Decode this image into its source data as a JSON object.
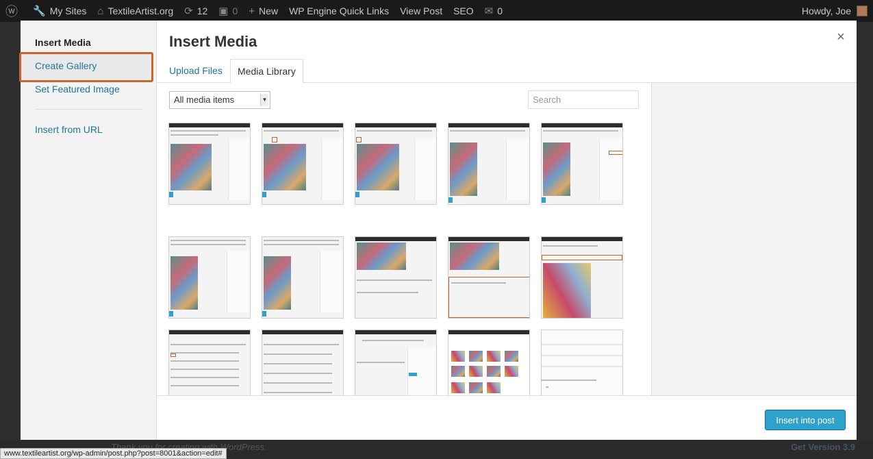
{
  "admin_bar": {
    "my_sites": "My Sites",
    "site_name": "TextileArtist.org",
    "updates_count": "12",
    "comments_count": "0",
    "new_label": "New",
    "wp_engine": "WP Engine Quick Links",
    "view_post": "View Post",
    "seo": "SEO",
    "notifications_count": "0",
    "howdy": "Howdy, Joe"
  },
  "background_page": {
    "thanks_text": "Thank you for creating with WordPress.",
    "get_version": "Get Version 3.9"
  },
  "status_url": "www.textileartist.org/wp-admin/post.php?post=8001&action=edit#",
  "modal": {
    "menu": {
      "heading": "Insert Media",
      "items": [
        "Create Gallery",
        "Set Featured Image",
        "Insert from URL"
      ]
    },
    "title": "Insert Media",
    "close": "×",
    "tabs": [
      "Upload Files",
      "Media Library"
    ],
    "active_tab": "Media Library",
    "filter": {
      "selected": "All media items",
      "arrow": "▼"
    },
    "search": {
      "placeholder": "Search"
    },
    "insert_button": "Insert into post"
  },
  "colors": {
    "accent": "#2ea2cc",
    "link": "#21759b",
    "highlight": "#c8642e"
  }
}
